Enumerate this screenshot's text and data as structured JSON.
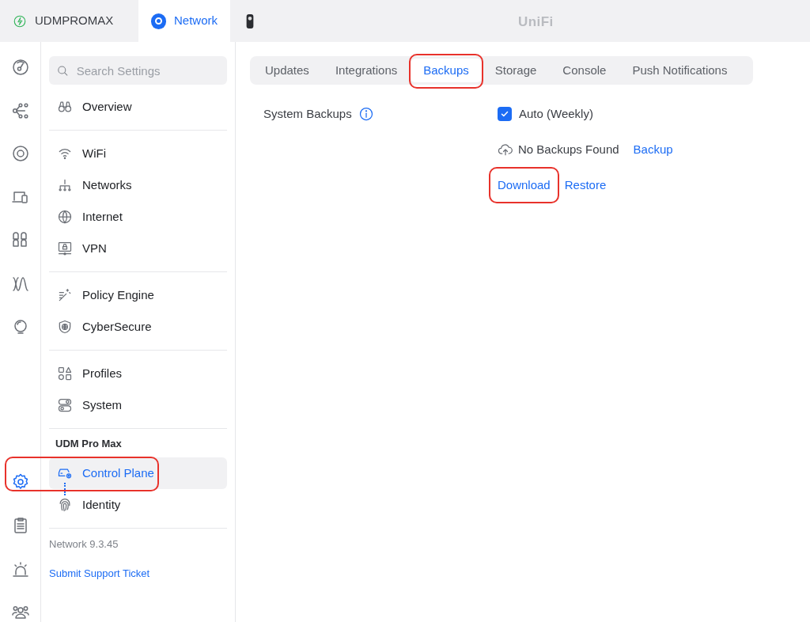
{
  "top_bar": {
    "tabs": [
      {
        "kind": "console",
        "label": "UDMPROMAX",
        "selected": false
      },
      {
        "kind": "app",
        "label": "Network",
        "selected": true
      },
      {
        "kind": "camera",
        "selected": false
      }
    ],
    "logo": "UniFi"
  },
  "rail": [
    {
      "selected": false,
      "circled": false
    },
    {
      "selected": false,
      "circled": false
    },
    {
      "selected": false,
      "circled": false
    },
    {
      "selected": false,
      "circled": false
    },
    {
      "selected": false,
      "circled": false
    },
    {
      "selected": false,
      "circled": false
    },
    {
      "selected": false,
      "circled": false
    },
    {
      "selected": true,
      "circled": true
    },
    {
      "selected": false,
      "circled": false
    },
    {
      "selected": false,
      "circled": false
    },
    {
      "selected": false,
      "circled": false
    }
  ],
  "sidebar": {
    "search": {
      "placeholder": "Search Settings"
    },
    "groups": [
      {
        "items": [
          {
            "label": "Overview",
            "selected": false,
            "circled": false
          }
        ]
      },
      {
        "items": [
          {
            "label": "WiFi",
            "selected": false,
            "circled": false
          },
          {
            "label": "Networks",
            "selected": false,
            "circled": false
          },
          {
            "label": "Internet",
            "selected": false,
            "circled": false
          },
          {
            "label": "VPN",
            "selected": false,
            "circled": false
          }
        ]
      },
      {
        "items": [
          {
            "label": "Policy Engine",
            "selected": false,
            "circled": false
          },
          {
            "label": "CyberSecure",
            "selected": false,
            "circled": false
          }
        ]
      },
      {
        "items": [
          {
            "label": "Profiles",
            "selected": false,
            "circled": false
          },
          {
            "label": "System",
            "selected": false,
            "circled": false
          }
        ]
      },
      {
        "heading": "UDM Pro Max",
        "items": [
          {
            "label": "Control Plane",
            "selected": true,
            "circled": true
          },
          {
            "label": "Identity",
            "selected": false,
            "circled": false
          }
        ]
      }
    ],
    "version": "Network 9.3.45",
    "support_link": "Submit Support Ticket"
  },
  "content": {
    "tabs": [
      {
        "label": "Updates",
        "selected": false,
        "circled": false
      },
      {
        "label": "Integrations",
        "selected": false,
        "circled": false
      },
      {
        "label": "Backups",
        "selected": true,
        "circled": true
      },
      {
        "label": "Storage",
        "selected": false,
        "circled": false
      },
      {
        "label": "Console",
        "selected": false,
        "circled": false
      },
      {
        "label": "Push Notifications",
        "selected": false,
        "circled": false
      }
    ],
    "section": {
      "label": "System Backups",
      "auto": {
        "label": "Auto (Weekly)",
        "checked": true
      },
      "status": "No Backups Found",
      "backup_link": {
        "label": "Backup",
        "circled": false
      },
      "actions": [
        {
          "label": "Download",
          "circled": true
        },
        {
          "label": "Restore",
          "circled": false
        }
      ]
    }
  }
}
